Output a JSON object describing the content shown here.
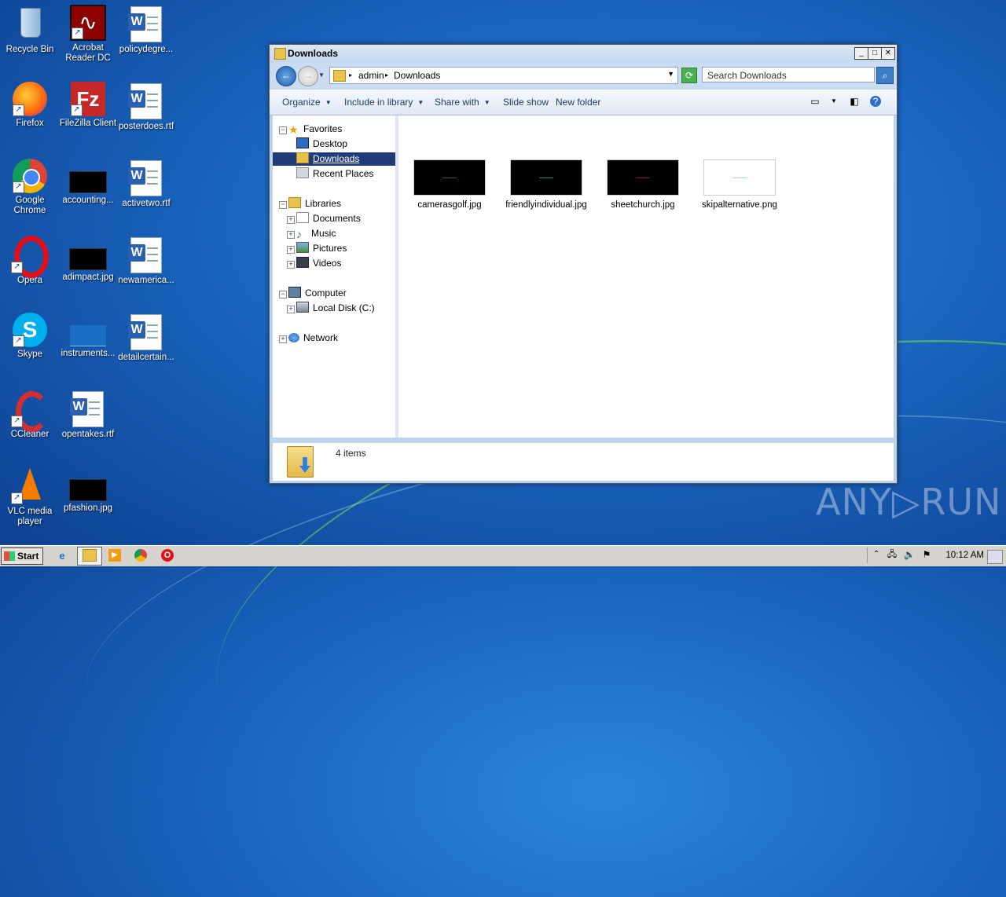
{
  "desktop": {
    "icons": [
      {
        "label": "Recycle Bin"
      },
      {
        "label": "Acrobat Reader DC"
      },
      {
        "label": "policydegre..."
      },
      {
        "label": "Firefox"
      },
      {
        "label": "FileZilla Client"
      },
      {
        "label": "posterdoes.rtf"
      },
      {
        "label": "Google Chrome"
      },
      {
        "label": "accounting..."
      },
      {
        "label": "activetwo.rtf"
      },
      {
        "label": "Opera"
      },
      {
        "label": "adimpact.jpg"
      },
      {
        "label": "newamerica..."
      },
      {
        "label": "Skype"
      },
      {
        "label": "instruments..."
      },
      {
        "label": "detailcertain..."
      },
      {
        "label": "CCleaner"
      },
      {
        "label": "opentakes.rtf"
      },
      {
        "label": "VLC media player"
      },
      {
        "label": "pfashion.jpg"
      }
    ]
  },
  "window": {
    "title": "Downloads",
    "breadcrumb": [
      "admin",
      "Downloads"
    ],
    "search_placeholder": "Search Downloads",
    "commands": [
      "Organize",
      "Include in library",
      "Share with",
      "Slide show",
      "New folder"
    ],
    "nav": {
      "favorites": "Favorites",
      "desktop": "Desktop",
      "downloads": "Downloads",
      "recent": "Recent Places",
      "libraries": "Libraries",
      "documents": "Documents",
      "music": "Music",
      "pictures": "Pictures",
      "videos": "Videos",
      "computer": "Computer",
      "local_disk": "Local Disk (C:)",
      "network": "Network"
    },
    "files": [
      {
        "name": "camerasgolf.jpg",
        "thumb_bg": "#000000",
        "mark": "#1e6b3a"
      },
      {
        "name": "friendlyindividual.jpg",
        "thumb_bg": "#000000",
        "mark": "#2e8b57"
      },
      {
        "name": "sheetchurch.jpg",
        "thumb_bg": "#000000",
        "mark": "#8b1a3a"
      },
      {
        "name": "skipalternative.png",
        "thumb_bg": "#ffffff",
        "mark": "#9be39b"
      }
    ],
    "status": "4 items"
  },
  "taskbar": {
    "start_label": "Start",
    "clock": "10:12 AM"
  },
  "watermark": "ANY▷RUN"
}
